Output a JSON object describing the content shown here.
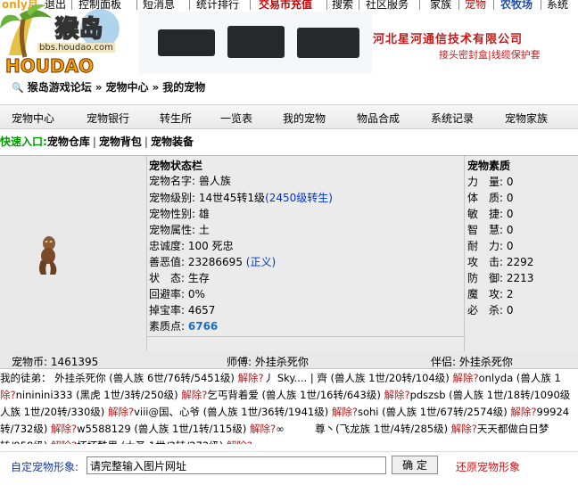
{
  "top_nav": {
    "items": [
      "only月",
      "退出",
      "控制面板",
      "短消息",
      "统计排行",
      "交易市充值",
      "搜索",
      "社区服务",
      "家族",
      "宠物",
      "农牧场",
      "系统"
    ],
    "active_color": "#cc0000"
  },
  "logo": {
    "name": "猴岛",
    "url_text": "bbs.houdao.com",
    "word": "HOUDAO"
  },
  "banner": {
    "company": "河北星河通信技术有限公司",
    "slogan": "接头密封盒|线缆保护套"
  },
  "breadcrumb": [
    "猴岛游戏论坛",
    "宠物中心",
    "我的宠物"
  ],
  "menu": [
    "宠物中心",
    "宠物银行",
    "转生所",
    "一览表",
    "我的宠物",
    "物品合成",
    "系统记录",
    "宠物家族"
  ],
  "quick_links": {
    "label": "快速入口:",
    "items": [
      "宠物仓库",
      "宠物背包",
      "宠物装备"
    ]
  },
  "status": {
    "title": "宠物状态栏",
    "rows": [
      {
        "k": "宠物名字:",
        "v": "兽人族"
      },
      {
        "k": "宠物级别:",
        "v": "14世45转1级",
        "link": "(2450级转生)"
      },
      {
        "k": "宠物性别:",
        "v": "雄"
      },
      {
        "k": "宠物属性:",
        "v": "土"
      },
      {
        "k": "忠诚度:",
        "v": "100 死忠"
      },
      {
        "k": "善恶值:",
        "v": "23286695",
        "link": "(正义)"
      },
      {
        "k": "状　态:",
        "v": "生存"
      },
      {
        "k": "回避率:",
        "v": "0%"
      },
      {
        "k": "掉宝率:",
        "v": "4657"
      },
      {
        "k": "素质点:",
        "v": "",
        "bold": "6766"
      }
    ]
  },
  "traits": {
    "title": "宠物素质",
    "rows": [
      {
        "k": "力　量:",
        "v": "0"
      },
      {
        "k": "体　质:",
        "v": "0"
      },
      {
        "k": "敏　捷:",
        "v": "0"
      },
      {
        "k": "智　慧:",
        "v": "0"
      },
      {
        "k": "耐　力:",
        "v": "0"
      },
      {
        "k": "攻　击:",
        "v": "2292"
      },
      {
        "k": "防　御:",
        "v": "2213"
      },
      {
        "k": "魔　攻:",
        "v": "2"
      },
      {
        "k": "必　杀:",
        "v": "0"
      }
    ]
  },
  "coins": {
    "coin": "宠物币: 1461395",
    "master": "师傅: 外挂杀死你",
    "partner": "伴侣: 外挂杀死你"
  },
  "disciples": {
    "lines": [
      [
        {
          "t": "我的徒弟：  外挂杀死你 (兽人族 6世/76转/5451级) "
        },
        {
          "t": "解除?",
          "r": 1
        },
        {
          "t": "丿 Sky.... | 齊 (兽人族 1世/20转/104级) "
        },
        {
          "t": "解除?",
          "r": 1
        },
        {
          "t": "onlyda (兽人族 1"
        }
      ],
      [
        {
          "t": "除?",
          "r": 1
        },
        {
          "t": "nininini333 (黑虎 1世/3转/250级) "
        },
        {
          "t": "解除?",
          "r": 1
        },
        {
          "t": "乞丐背着爱 (兽人族 1世/16转/643级) "
        },
        {
          "t": "解除?",
          "r": 1
        },
        {
          "t": "pdszsb (兽人族 1世/18转/1090级"
        }
      ],
      [
        {
          "t": "人族 1世/20转/330级) "
        },
        {
          "t": "解除?",
          "r": 1
        },
        {
          "t": "viii@国、心爷 (兽人族 1世/36转/1941级) "
        },
        {
          "t": "解除?",
          "r": 1
        },
        {
          "t": "sohi (兽人族 1世/67转/2574级) "
        },
        {
          "t": "解除?",
          "r": 1
        },
        {
          "t": "99924"
        }
      ],
      [
        {
          "t": "转/732级) "
        },
        {
          "t": "解除?",
          "r": 1
        },
        {
          "t": "w5588129 (兽人族 1世/1转/115级) "
        },
        {
          "t": "解除?",
          "r": 1
        },
        {
          "t": "∞　　　尊丶(飞龙族 1世/4转/285级) "
        },
        {
          "t": "解除?",
          "r": 1
        },
        {
          "t": "天天都做白日梦"
        }
      ],
      [
        {
          "t": "转/958级) "
        },
        {
          "t": "解除?",
          "r": 1
        },
        {
          "t": "坏坏酷男 (大圣 1世/2转/272级) "
        },
        {
          "t": "解除?",
          "r": 1
        }
      ]
    ]
  },
  "custom": {
    "label": "自定宠物形象:",
    "input_value": "请完整输入图片网址",
    "button": "确 定",
    "restore": "还原宠物形象"
  }
}
